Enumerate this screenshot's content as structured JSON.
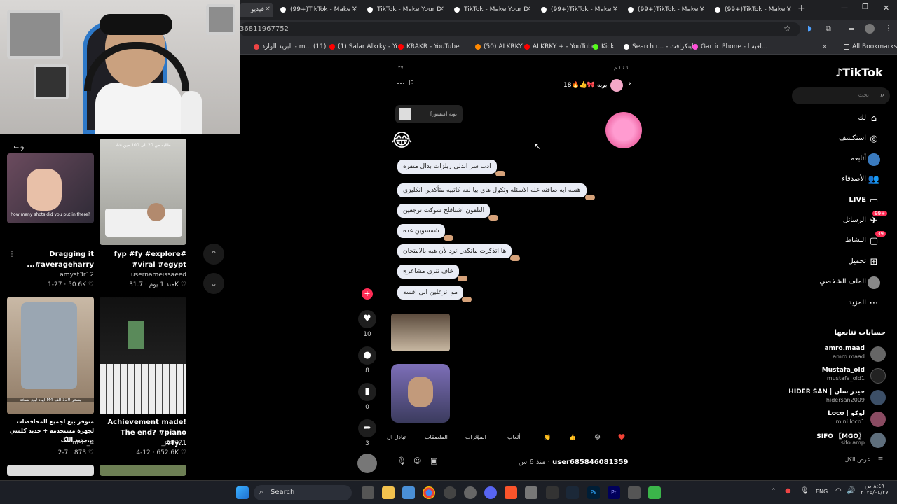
{
  "browser": {
    "tabs": [
      {
        "label": "فيديو",
        "active": true
      },
      {
        "label": "(99+)TikTok - Make Y",
        "active": false
      },
      {
        "label": "TikTok - Make Your D",
        "active": false
      },
      {
        "label": "TikTok - Make Your D",
        "active": false
      },
      {
        "label": "(99+)TikTok - Make Y",
        "active": false
      },
      {
        "label": "(99+)TikTok - Make Y",
        "active": false
      },
      {
        "label": "(99+)TikTok - Make Y",
        "active": false
      }
    ],
    "new_tab_icon": "plus-icon",
    "url": "3681196775 2",
    "url_display": "36811967752",
    "bookmarks": [
      "البريد الوارد - m... (11)",
      "(1) Salar Alkrky - Yo...",
      "KRAKR - YouTube",
      "(50) ALKRKY",
      "ALKRKY + - YouTube",
      "Kick",
      "Search r... - ماينكرافت",
      "Gartic Phone - لعبة ا...",
      "All Bookmarks"
    ]
  },
  "left_feed": {
    "streak_label": "2",
    "videos": [
      {
        "title": "Dragging it ...#averageharry",
        "author": "amyst3r12",
        "date": "1-27",
        "likes": "50.6K",
        "overlay": "how many shots did you put in there?"
      },
      {
        "title": "fyp #fy #explore# #viral #egypt",
        "author": "usernameissaeed",
        "date": "منذ 1 يوم",
        "likes": "31.7K",
        "overlay": "طالبه من 20 الى 100 مين شاد"
      },
      {
        "title": "متوفر بيع لجميع المحافضات لجهزة مستخدمة + جديد كلشي جديد اللگ...",
        "author": "mstr_4",
        "date": "2-7",
        "likes": "873",
        "overlay": "ايباد لبيع نسخة M4 بسعر 120 الف"
      },
      {
        "title": "Achievement made! The end? #piano #fy...",
        "author": "_jp0721",
        "date": "4-12",
        "likes": "652.6K",
        "overlay": ""
      }
    ]
  },
  "chat": {
    "status_time": "١:٤٦ م",
    "status_left": "٢٧",
    "contact_name": "يويه",
    "contact_suffix": "18",
    "pinned_preview": "يويه [منشور]",
    "messages": [
      "ادب سز اندلي ريلزات بدال متقره",
      "هسه ايه صافنه عله الاسئله وتكول هاي بيا لغه كاتبيه متأكدين انكليزي",
      "التلفون اشتاقلج شوكت ترجعين",
      "شمسوين غده",
      "ها اتذكرت ماتكدر اترد لأن هيه بالامتحان",
      "خاف تنزي مشاعرج",
      "مو انزعلين اني افسه"
    ],
    "quick_replies": [
      "❤️",
      "😂",
      "👍",
      "👏",
      "ألعاب",
      "المؤثرات",
      "الملصقات",
      "تبادل ال"
    ],
    "sender_name": "user685846081359",
    "sender_time": "منذ 6 س",
    "actions": {
      "likes": "10",
      "comments": "8",
      "saves": "0",
      "shares": "3"
    }
  },
  "right_nav": {
    "logo": "TikTok",
    "search_placeholder": "بحث",
    "items": [
      {
        "label": "لك",
        "icon": "home-icon"
      },
      {
        "label": "استكشف",
        "icon": "compass-icon"
      },
      {
        "label": "أتابعه",
        "icon": "following-icon"
      },
      {
        "label": "الأصدقاء",
        "icon": "friends-icon"
      },
      {
        "label": "LIVE",
        "icon": "live-icon"
      },
      {
        "label": "الرسائل",
        "icon": "message-icon",
        "badge": "99+"
      },
      {
        "label": "النشاط",
        "icon": "activity-icon",
        "badge": "39"
      },
      {
        "label": "تحميل",
        "icon": "upload-icon"
      },
      {
        "label": "الملف الشخصي",
        "icon": "profile-icon"
      },
      {
        "label": "المزيد",
        "icon": "more-icon"
      }
    ],
    "following_title": "حسابات تتابعها",
    "following": [
      {
        "name": "amro.maad",
        "handle": "amro.maad"
      },
      {
        "name": "Mustafa_old",
        "handle": "mustafa_old1"
      },
      {
        "name": "HIDER SAN | حيدر سان",
        "handle": "hidersan2009"
      },
      {
        "name": "Loco | لوكو",
        "handle": "mini.loco1"
      },
      {
        "name": "SIFO 〖MGO〗",
        "handle": "sifo.amp"
      }
    ],
    "see_all": "عرض الكل"
  },
  "taskbar": {
    "search_label": "Search",
    "lang": "ENG",
    "time": "٨:٤٩ ص",
    "date": "٢٠٢٥/٠٤/٢٧"
  }
}
